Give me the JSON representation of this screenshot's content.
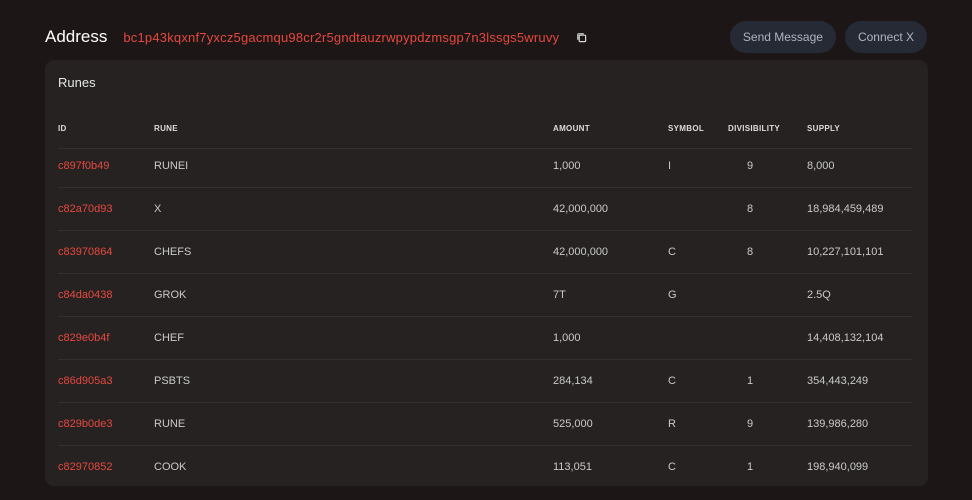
{
  "header": {
    "label": "Address",
    "address": "bc1p43kqxnf7yxcz5gacmqu98cr2r5gndtauzrwpypdzmsgp7n3lssgs5wruvy",
    "send_message_label": "Send Message",
    "connect_label": "Connect X"
  },
  "panel": {
    "title": "Runes"
  },
  "table": {
    "columns": {
      "id": "ID",
      "rune": "RUNE",
      "amount": "AMOUNT",
      "symbol": "SYMBOL",
      "divisibility": "DIVISIBILITY",
      "supply": "SUPPLY"
    },
    "rows": [
      {
        "id": "c897f0b49",
        "rune": "RUNEI",
        "amount": "1,000",
        "symbol": "I",
        "divisibility": "9",
        "supply": "8,000"
      },
      {
        "id": "c82a70d93",
        "rune": "X",
        "amount": "42,000,000",
        "symbol": "",
        "divisibility": "8",
        "supply": "18,984,459,489"
      },
      {
        "id": "c83970864",
        "rune": "CHEFS",
        "amount": "42,000,000",
        "symbol": "C",
        "divisibility": "8",
        "supply": "10,227,101,101"
      },
      {
        "id": "c84da0438",
        "rune": "GROK",
        "amount": "7T",
        "symbol": "G",
        "divisibility": "",
        "supply": "2.5Q"
      },
      {
        "id": "c829e0b4f",
        "rune": "CHEF",
        "amount": "1,000",
        "symbol": "",
        "divisibility": "",
        "supply": "14,408,132,104"
      },
      {
        "id": "c86d905a3",
        "rune": "PSBTS",
        "amount": "284,134",
        "symbol": "C",
        "divisibility": "1",
        "supply": "354,443,249"
      },
      {
        "id": "c829b0de3",
        "rune": "RUNE",
        "amount": "525,000",
        "symbol": "R",
        "divisibility": "9",
        "supply": "139,986,280"
      },
      {
        "id": "c82970852",
        "rune": "COOK",
        "amount": "113,051",
        "symbol": "C",
        "divisibility": "1",
        "supply": "198,940,099"
      }
    ]
  },
  "colors": {
    "background": "#1c1616",
    "panel": "#272222",
    "accent": "#e5483f",
    "button_bg": "#262a35",
    "button_text": "#aeb3c2"
  },
  "icons": {
    "copy": "copy-icon"
  }
}
